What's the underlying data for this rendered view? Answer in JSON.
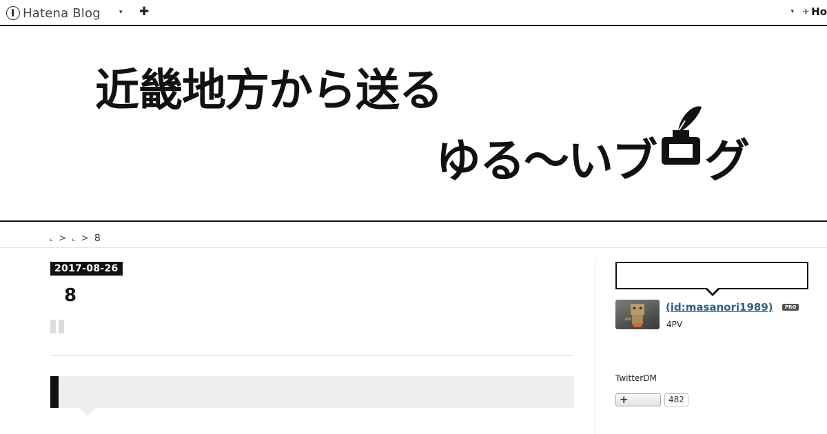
{
  "topbar": {
    "brand": "Hatena Blog",
    "plus": "✚",
    "right_brand": "Ho"
  },
  "header": {
    "title_line1": "近畿地方から送る",
    "title_line2_a": "ゆる〜いブ",
    "title_line2_b": "グ"
  },
  "breadcrumb": {
    "items": [
      "⌞",
      "⌞"
    ],
    "separator": ">",
    "current": "8"
  },
  "entry": {
    "date": "2017-08-26",
    "title": "8"
  },
  "sidebar": {
    "profile_name": " (id:masanori1989)",
    "pro": "PRO",
    "pv": "4PV",
    "twitter_dm": "TwitterDM",
    "follow_count": "482"
  }
}
